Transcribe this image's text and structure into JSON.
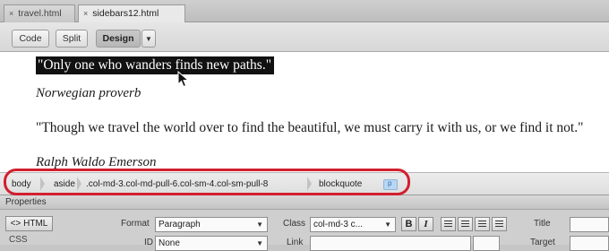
{
  "tabs": [
    {
      "label": "travel.html",
      "close": "×"
    },
    {
      "label": "sidebars12.html",
      "close": "×"
    }
  ],
  "viewbar": {
    "code": "Code",
    "split": "Split",
    "design": "Design",
    "dropdown_caret": "▼"
  },
  "document": {
    "quote1": "\"Only one who wanders finds new paths.\"",
    "author1": "Norwegian proverb",
    "quote2": "\"Though we travel the world over to find the beautiful, we must carry it with us, or we find it not.\"",
    "author2": "Ralph Waldo Emerson"
  },
  "tag_selector": {
    "tags": [
      "body",
      "aside",
      ".col-md-3.col-md-pull-6.col-sm-4.col-sm-pull-8",
      "blockquote"
    ],
    "highlight_color": "#d21f2e"
  },
  "properties": {
    "title": "Properties",
    "html_button": "<> HTML",
    "css_button": "CSS",
    "format_label": "Format",
    "format_value": "Paragraph",
    "class_label": "Class",
    "class_value": "col-md-3 c...",
    "id_label": "ID",
    "id_value": "None",
    "link_label": "Link",
    "title_label": "Title",
    "target_label": "Target",
    "bold": "B",
    "italic": "I"
  }
}
